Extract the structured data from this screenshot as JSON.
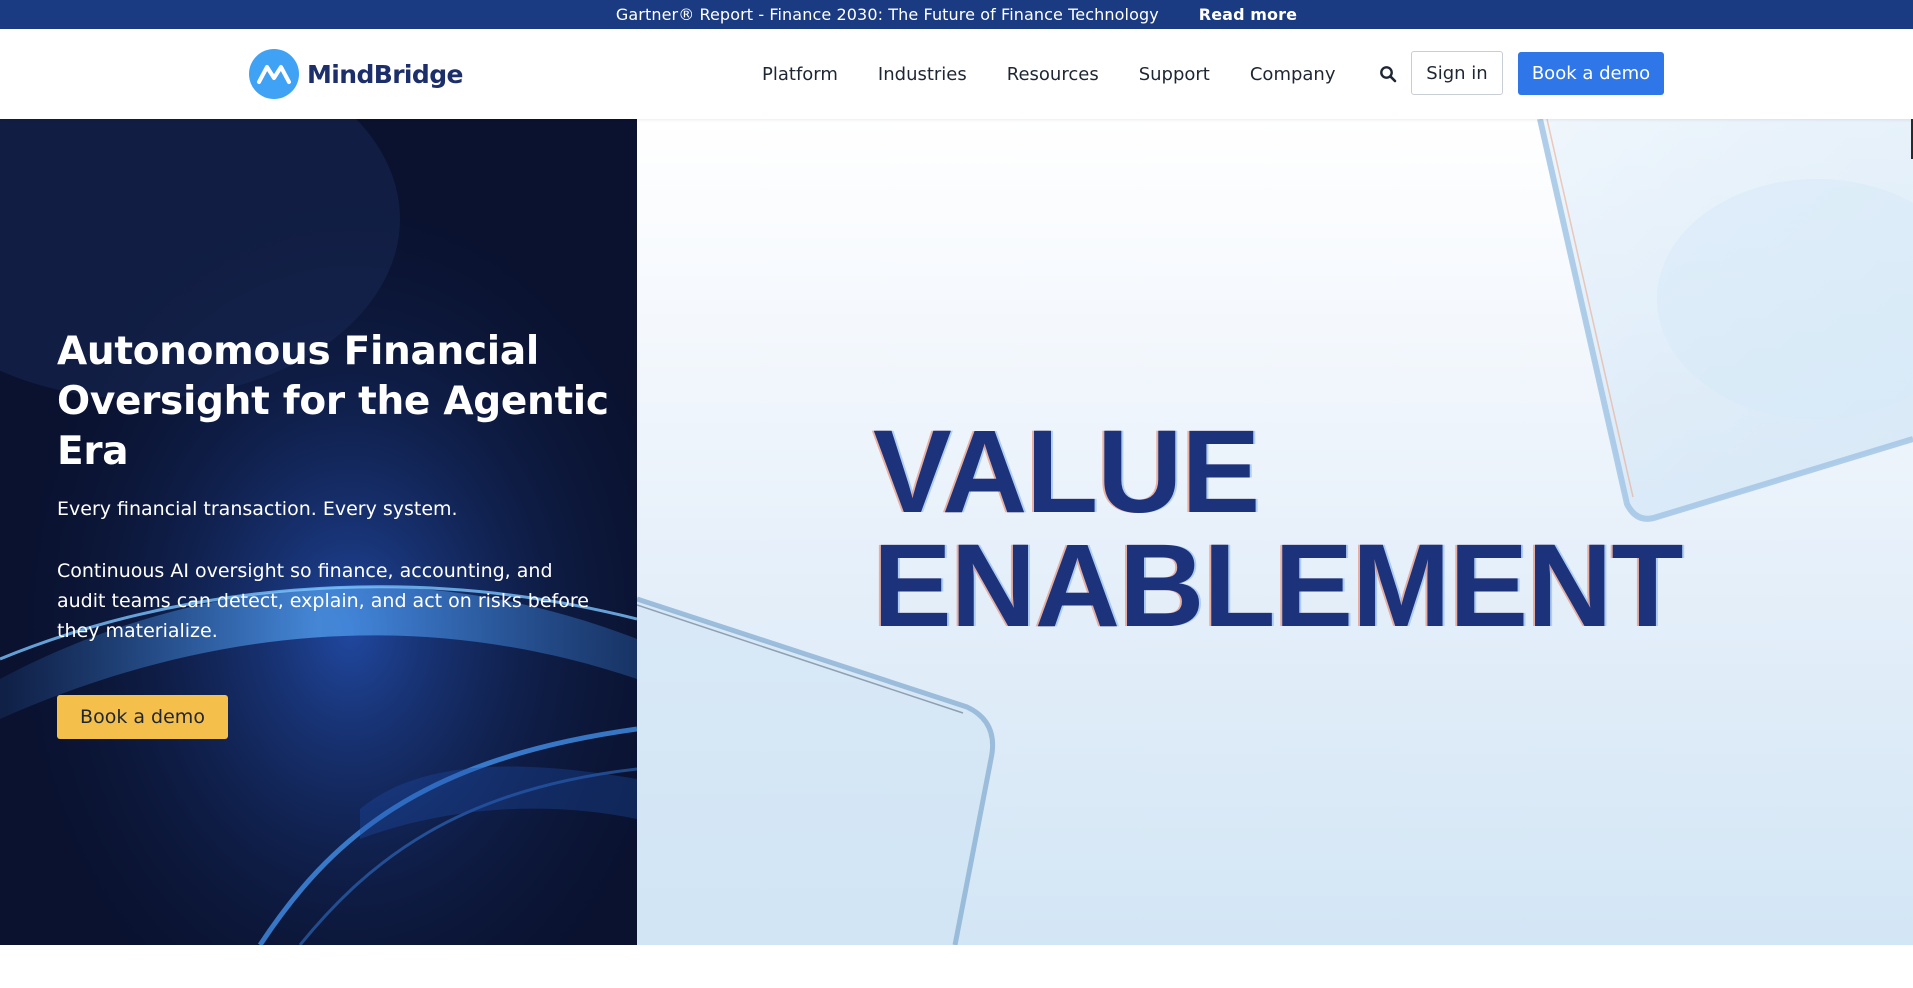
{
  "announcement": {
    "text": "Gartner® Report - Finance 2030: The Future of Finance Technology",
    "link_label": "Read more"
  },
  "header": {
    "logo_text": "MindBridge",
    "nav": [
      "Platform",
      "Industries",
      "Resources",
      "Support",
      "Company"
    ],
    "search_icon": "search-icon",
    "signin_label": "Sign in",
    "demo_label": "Book a demo"
  },
  "hero": {
    "title": "Autonomous Financial Oversight for the Agentic Era",
    "line1": "Every financial transaction. Every system.",
    "paragraph": "Continuous AI oversight so finance, accounting, and audit teams can detect, explain, and act on risks before they materialize.",
    "cta_label": "Book a demo",
    "visual_line1": "VALUE",
    "visual_line2": "ENABLEMENT"
  },
  "colors": {
    "announce_bg": "#1a3a82",
    "brand_blue": "#2f76e8",
    "brand_navy": "#1c337c",
    "logo_blue": "#3fa2f5",
    "cta_yellow": "#f4c04b",
    "hero_dark": "#0b1430"
  }
}
